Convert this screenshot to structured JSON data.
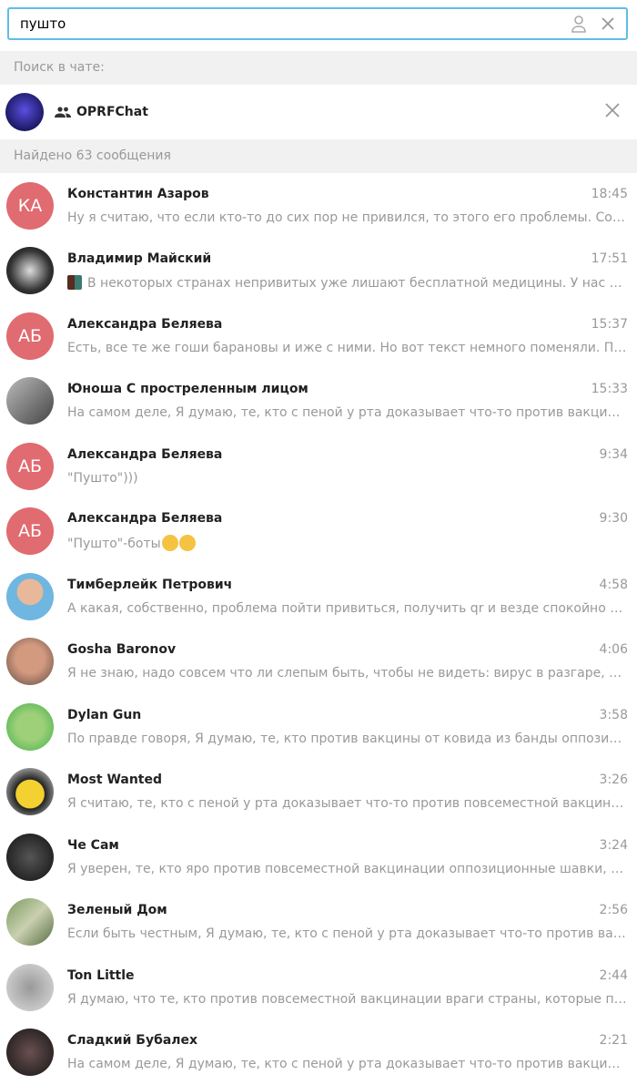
{
  "search": {
    "value": "пушто",
    "icons": [
      "user-icon",
      "close-icon"
    ]
  },
  "chat_section_label": "Поиск в чате:",
  "chat": {
    "name": "OPRFChat",
    "icon": "group-icon"
  },
  "results_label": "Найдено 63 сообщения",
  "colors": {
    "accent": "#5fbde8",
    "initials_avatar": "#e06b70"
  },
  "results": [
    {
      "initials": "КА",
      "name": "Константин Азаров",
      "time": "18:45",
      "text": "Ну я считаю, что если кто-то до сих пор не привился, то этого его проблемы. Сознательные граждане"
    },
    {
      "name": "Владимир Майский",
      "time": "17:51",
      "text": "В некоторых странах непривитых уже лишают бесплатной медицины. У нас пока",
      "thumb": true
    },
    {
      "initials": "АБ",
      "name": "Александра Беляева",
      "time": "15:37",
      "text": "Есть, все те же гоши барановы и иже с ними. Но вот текст немного поменяли. По сути"
    },
    {
      "name": "Юноша С простреленным лицом",
      "time": "15:33",
      "text": "На самом деле, Я думаю, те, кто с пеной у рта доказывает что-то против вакцины от"
    },
    {
      "initials": "АБ",
      "name": "Александра Беляева",
      "time": "9:34",
      "text": "\"Пушто\")))"
    },
    {
      "initials": "АБ",
      "name": "Александра Беляева",
      "time": "9:30",
      "text": "\"Пушто\"-боты",
      "emoji": [
        "face-with-monocle",
        "shushing-face"
      ]
    },
    {
      "name": "Тимберлейк Петрович",
      "time": "4:58",
      "text": "А какая, собственно, проблема пойти привиться, получить qr и везде спокойно ходить"
    },
    {
      "name": "Gosha Baronov",
      "time": "4:06",
      "text": "Я не знаю, надо совсем что ли слепым быть, чтобы не видеть: вирус в разгаре, каждый"
    },
    {
      "name": "Dylan Gun",
      "time": "3:58",
      "text": "По правде говоря, Я думаю, те, кто против вакцины от ковида из банды оппозиционеров"
    },
    {
      "name": "Most Wanted",
      "time": "3:26",
      "text": "Я считаю, те, кто с пеной у рта доказывает что-то против повсеместной вакцинации"
    },
    {
      "name": "Че Сам",
      "time": "3:24",
      "text": "Я уверен, те, кто яро против повсеместной вакцинации оппозиционные шавки, продажные"
    },
    {
      "name": "Зеленый Дом",
      "time": "2:56",
      "text": "Если быть честным, Я думаю, те, кто с пеной у рта доказывает что-то против вакцины"
    },
    {
      "name": "Ton Little",
      "time": "2:44",
      "text": "Я думаю, что те, кто против повсеместной вакцинации враги страны, которые продались"
    },
    {
      "name": "Сладкий Бубалех",
      "time": "2:21",
      "text": "На самом деле, Я думаю, те, кто с пеной у рта доказывает что-то против вакцины от"
    }
  ]
}
